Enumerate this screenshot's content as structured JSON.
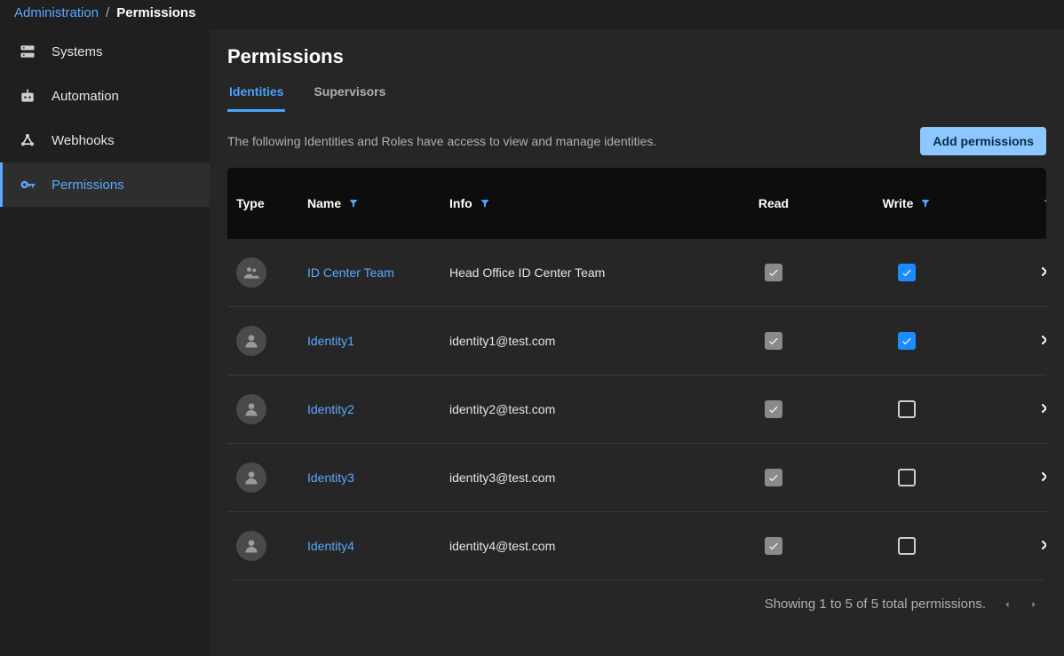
{
  "breadcrumb": {
    "parent": "Administration",
    "current": "Permissions"
  },
  "sidebar": {
    "items": [
      {
        "label": "Systems",
        "icon": "systems",
        "active": false
      },
      {
        "label": "Automation",
        "icon": "automation",
        "active": false
      },
      {
        "label": "Webhooks",
        "icon": "webhooks",
        "active": false
      },
      {
        "label": "Permissions",
        "icon": "permissions",
        "active": true
      }
    ]
  },
  "page": {
    "title": "Permissions"
  },
  "tabs": [
    {
      "label": "Identities",
      "active": true
    },
    {
      "label": "Supervisors",
      "active": false
    }
  ],
  "description": "The following Identities and Roles have access to view and manage identities.",
  "buttons": {
    "add": "Add permissions"
  },
  "columns": {
    "type": "Type",
    "name": "Name",
    "info": "Info",
    "read": "Read",
    "write": "Write"
  },
  "rows": [
    {
      "type": "group",
      "name": "ID Center Team",
      "info": "Head Office ID Center Team",
      "read_locked": true,
      "write": true
    },
    {
      "type": "user",
      "name": "Identity1",
      "info": "identity1@test.com",
      "read_locked": true,
      "write": true
    },
    {
      "type": "user",
      "name": "Identity2",
      "info": "identity2@test.com",
      "read_locked": true,
      "write": false
    },
    {
      "type": "user",
      "name": "Identity3",
      "info": "identity3@test.com",
      "read_locked": true,
      "write": false
    },
    {
      "type": "user",
      "name": "Identity4",
      "info": "identity4@test.com",
      "read_locked": true,
      "write": false
    }
  ],
  "pager": {
    "status": "Showing 1 to 5 of 5 total permissions."
  }
}
